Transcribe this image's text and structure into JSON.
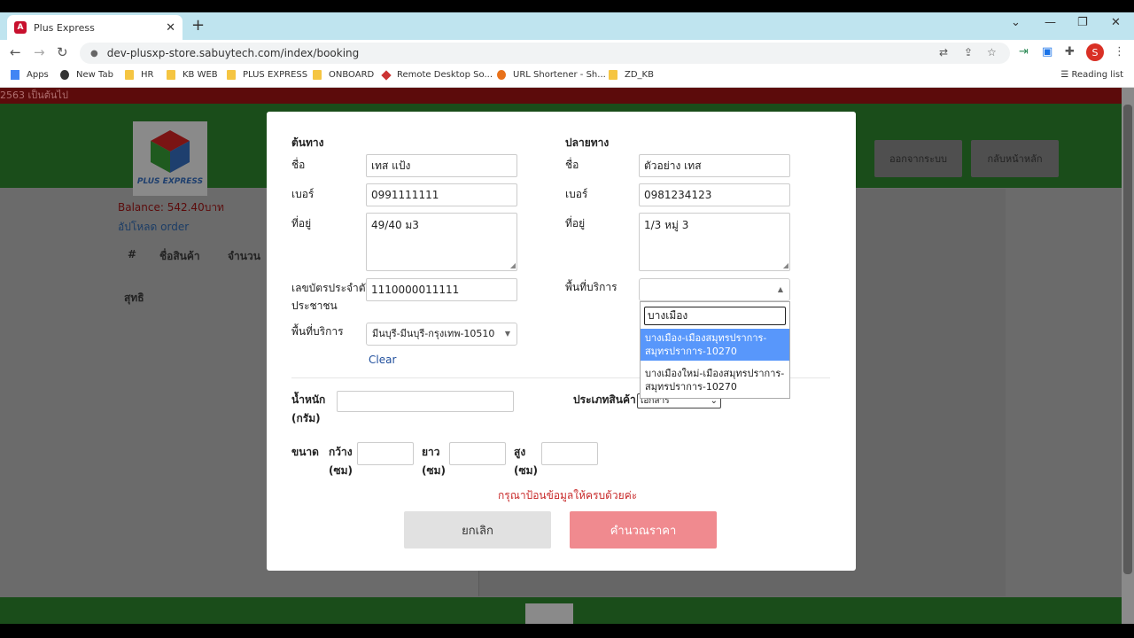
{
  "browser": {
    "tab_title": "Plus Express",
    "favicon_letter": "A",
    "url": "dev-plusxp-store.sabuytech.com/index/booking",
    "profile_initial": "S",
    "bookmarks": [
      "Apps",
      "New Tab",
      "HR",
      "KB WEB",
      "PLUS EXPRESS",
      "ONBOARD",
      "Remote Desktop So...",
      "URL Shortener - Sh...",
      "ZD_KB"
    ],
    "reading_list": "Reading list"
  },
  "background": {
    "marquee": "2563 เป็นต้นไป",
    "logo_text": "PLUS EXPRESS",
    "logout_button": "ออกจากระบบ",
    "home_button": "กลับหน้าหลัก",
    "balance": "Balance: 542.40บาท",
    "upload_order": "อัปโหลด order",
    "table_headers": [
      "#",
      "ชื่อสินค้า",
      "จำนวน"
    ],
    "net_label": "สุทธิ"
  },
  "modal": {
    "origin": {
      "heading": "ต้นทาง",
      "name_label": "ชื่อ",
      "name_value": "เทส แป้ง",
      "phone_label": "เบอร์",
      "phone_value": "0991111111",
      "address_label": "ที่อยู่",
      "address_value": "49/40 ม3",
      "id_label_1": "เลขบัตรประจำตัว",
      "id_label_2": "ประชาชน",
      "id_value": "1110000011111",
      "area_label": "พื้นที่บริการ",
      "area_value": "มีนบุรี-มีนบุรี-กรุงเทพ-10510",
      "clear_link": "Clear"
    },
    "destination": {
      "heading": "ปลายทาง",
      "name_label": "ชื่อ",
      "name_value": "ตัวอย่าง เทส",
      "phone_label": "เบอร์",
      "phone_value": "0981234123",
      "address_label": "ที่อยู่",
      "address_value": "1/3 หมู่ 3",
      "area_label": "พื้นที่บริการ",
      "area_value": ""
    },
    "weight_label_1": "น้ำหนัก",
    "weight_label_2": "(กรัม)",
    "weight_value": "",
    "product_type_label": "ประเภทสินค้า",
    "product_type_value": "เอกสาร",
    "size_label": "ขนาด",
    "width_label_1": "กว้าง",
    "width_label_2": "(ซม)",
    "length_label_1": "ยาว",
    "length_label_2": "(ซม)",
    "height_label_1": "สูง",
    "height_label_2": "(ซม)",
    "error_message": "กรุณาป้อนข้อมูลให้ครบด้วยค่ะ",
    "cancel_button": "ยกเลิก",
    "calculate_button": "คำนวณราคา"
  },
  "dropdown": {
    "search_value": "บางเมือง",
    "options": [
      "บางเมือง-เมืองสมุทรปราการ-สมุทรปราการ-10270",
      "บางเมืองใหม่-เมืองสมุทรปราการ-สมุทรปราการ-10270"
    ]
  }
}
